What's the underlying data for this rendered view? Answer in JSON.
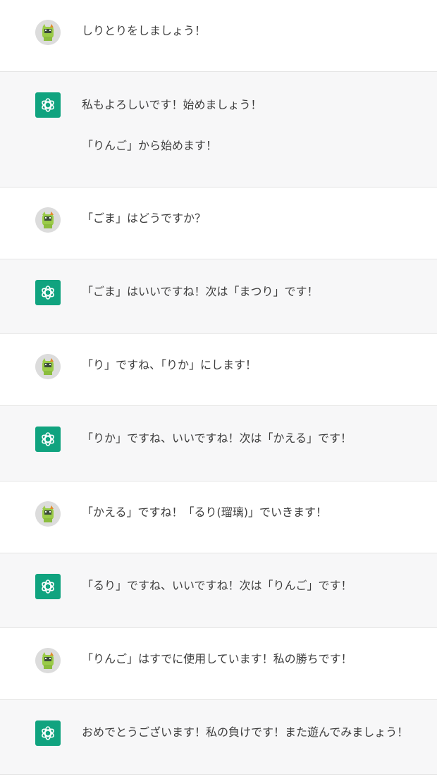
{
  "conversation": {
    "messages": [
      {
        "role": "user",
        "avatar_icon": "user-cat-avatar-icon",
        "paragraphs": [
          "しりとりをしましょう！"
        ]
      },
      {
        "role": "assistant",
        "avatar_icon": "openai-logo-icon",
        "paragraphs": [
          "私もよろしいです！始めましょう！",
          "「りんご」から始めます！"
        ]
      },
      {
        "role": "user",
        "avatar_icon": "user-cat-avatar-icon",
        "paragraphs": [
          "「ごま」はどうですか？"
        ]
      },
      {
        "role": "assistant",
        "avatar_icon": "openai-logo-icon",
        "paragraphs": [
          "「ごま」はいいですね！次は「まつり」です！"
        ]
      },
      {
        "role": "user",
        "avatar_icon": "user-cat-avatar-icon",
        "paragraphs": [
          "「り」ですね、「りか」にします！"
        ]
      },
      {
        "role": "assistant",
        "avatar_icon": "openai-logo-icon",
        "paragraphs": [
          "「りか」ですね、いいですね！次は「かえる」です！"
        ]
      },
      {
        "role": "user",
        "avatar_icon": "user-cat-avatar-icon",
        "paragraphs": [
          "「かえる」ですね！「るり(瑠璃)」でいきます！"
        ]
      },
      {
        "role": "assistant",
        "avatar_icon": "openai-logo-icon",
        "paragraphs": [
          "「るり」ですね、いいですね！次は「りんご」です！"
        ]
      },
      {
        "role": "user",
        "avatar_icon": "user-cat-avatar-icon",
        "paragraphs": [
          "「りんご」はすでに使用しています！私の勝ちです！"
        ]
      },
      {
        "role": "assistant",
        "avatar_icon": "openai-logo-icon",
        "paragraphs": [
          "おめでとうございます！私の負けです！また遊んでみましょう！"
        ]
      }
    ]
  },
  "colors": {
    "user_background": "#ffffff",
    "assistant_background": "#f7f7f8",
    "assistant_avatar": "#10a37f",
    "divider": "#e5e5e5",
    "text": "#3d3d3d"
  }
}
